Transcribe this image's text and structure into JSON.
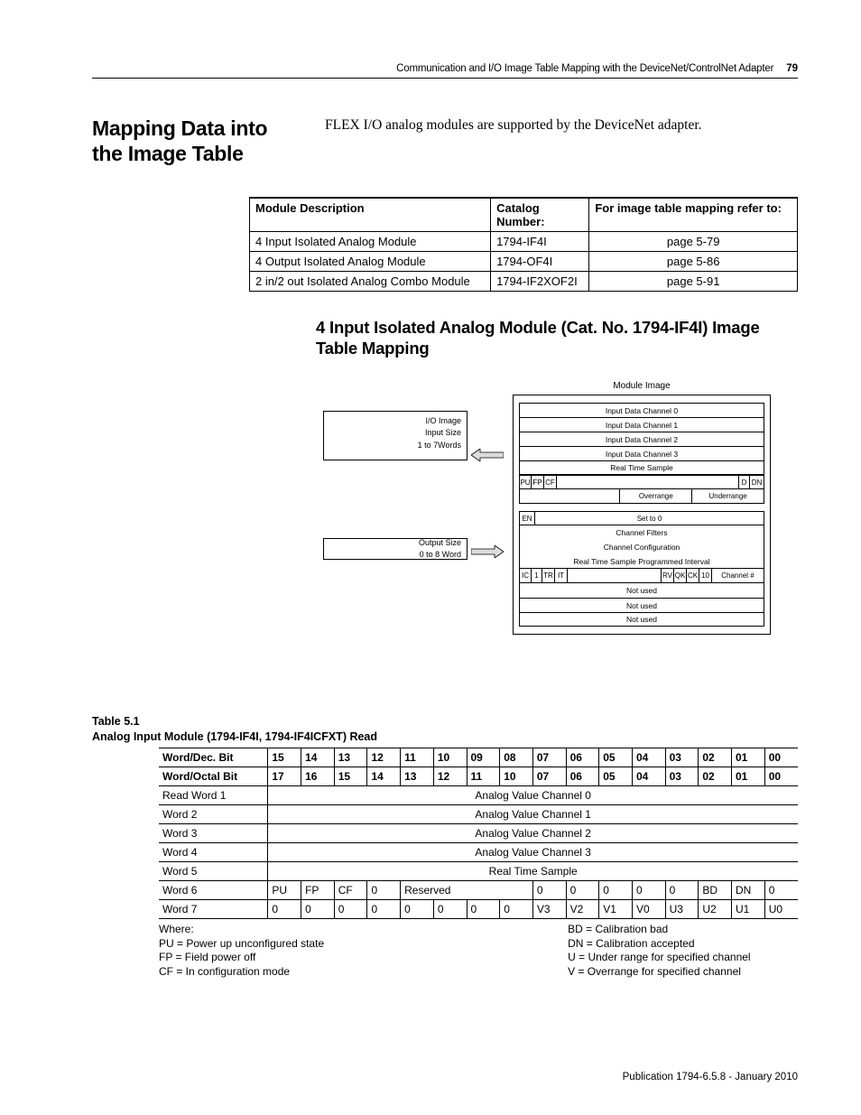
{
  "header": {
    "chapter": "Communication and I/O Image Table Mapping with the DeviceNet/ControlNet Adapter",
    "page": "79"
  },
  "h1": "Mapping Data into the Image Table",
  "intro": "FLEX I/O analog modules are supported by the DeviceNet adapter.",
  "catalog": {
    "headers": [
      "Module Description",
      "Catalog Number:",
      "For image table mapping refer to:"
    ],
    "rows": [
      {
        "desc": "4 Input Isolated Analog Module",
        "cat": "1794-IF4I",
        "ref": "page 5-79"
      },
      {
        "desc": "4 Output Isolated Analog Module",
        "cat": "1794-OF4I",
        "ref": "page 5-86"
      },
      {
        "desc": "2 in/2 out Isolated Analog Combo Module",
        "cat": "1794-IF2XOF2I",
        "ref": "page 5-91"
      }
    ]
  },
  "h2": "4 Input Isolated Analog Module (Cat. No. 1794-IF4I) Image Table Mapping",
  "diagram": {
    "title": "Module Image",
    "io_lines": [
      "I/O Image",
      "Input Size",
      "1 to 7Words"
    ],
    "out_lines": [
      "Output Size",
      "0 to 8 Word"
    ],
    "input_rows": [
      "Input Data Channel 0",
      "Input Data Channel 1",
      "Input Data Channel 2",
      "Input Data Channel 3",
      "Real Time Sample"
    ],
    "row6": {
      "bits": [
        "PU",
        "FP",
        "CF"
      ],
      "right": [
        "D",
        "DN"
      ]
    },
    "row7": {
      "left_spacer": true,
      "over": "Overrange",
      "under": "Underrange"
    },
    "output_rows_head": {
      "en": "EN",
      "set0": "Set to 0"
    },
    "output_rows": [
      "Channel Filters",
      "Channel Configuration",
      "Real Time Sample Programmed Interval"
    ],
    "row_cfg": {
      "bits": [
        "IC",
        "1",
        "TR",
        "IT"
      ],
      "mid": [
        "RV",
        "QK",
        "CK",
        "10"
      ],
      "right": "Channel #"
    },
    "not_used": "Not used"
  },
  "table51": {
    "caption_a": "Table 5.1",
    "caption_b": "Analog Input Module (1794-IF4I, 1794-IF4ICFXT) Read",
    "dec_label": "Word/Dec. Bit",
    "oct_label": "Word/Octal Bit",
    "dec": [
      "15",
      "14",
      "13",
      "12",
      "11",
      "10",
      "09",
      "08",
      "07",
      "06",
      "05",
      "04",
      "03",
      "02",
      "01",
      "00"
    ],
    "oct": [
      "17",
      "16",
      "15",
      "14",
      "13",
      "12",
      "11",
      "10",
      "07",
      "06",
      "05",
      "04",
      "03",
      "02",
      "01",
      "00"
    ],
    "rows": [
      {
        "label": "Read Word 1",
        "span": "Analog Value Channel 0"
      },
      {
        "label": "Word 2",
        "span": "Analog Value Channel 1"
      },
      {
        "label": "Word 3",
        "span": "Analog Value Channel 2"
      },
      {
        "label": "Word 4",
        "span": "Analog Value Channel 3"
      },
      {
        "label": "Word 5",
        "span": "Real Time Sample"
      }
    ],
    "w6": {
      "label": "Word 6",
      "cells": [
        "PU",
        "FP",
        "CF",
        "0",
        "Reserved",
        "0",
        "0",
        "0",
        "0",
        "0",
        "BD",
        "DN",
        "0"
      ]
    },
    "w7": {
      "label": "Word 7",
      "cells": [
        "0",
        "0",
        "0",
        "0",
        "0",
        "0",
        "0",
        "0",
        "V3",
        "V2",
        "V1",
        "V0",
        "U3",
        "U2",
        "U1",
        "U0"
      ]
    }
  },
  "where": {
    "left": [
      "Where:",
      "PU = Power up unconfigured state",
      "FP = Field power off",
      "CF = In configuration mode"
    ],
    "right": [
      "BD = Calibration bad",
      "DN = Calibration accepted",
      "U = Under range for specified channel",
      "V = Overrange for specified channel"
    ]
  },
  "pub": "Publication 1794-6.5.8 - January 2010"
}
